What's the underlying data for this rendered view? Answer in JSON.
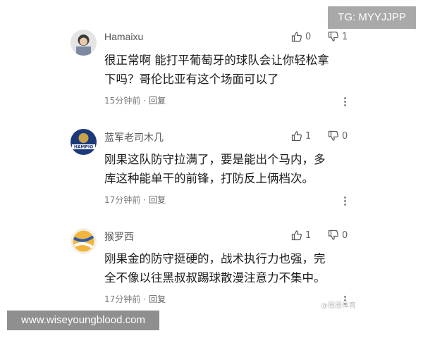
{
  "overlays": {
    "tg_badge": "TG: MYYJJPP",
    "site_watermark": "www.wiseyoungblood.com",
    "source_mark": "@圈圈体育"
  },
  "comments": [
    {
      "username": "Hamaixu",
      "likes": "0",
      "dislikes": "1",
      "line1": "很正常啊 能打平葡萄牙的球队会让你轻松拿",
      "line2": "下吗？哥伦比亚有这个场面可以了",
      "time": "15分钟前",
      "reply": "回复",
      "avatar_color": "#d8d8d8"
    },
    {
      "username": "蓝军老司木几",
      "likes": "1",
      "dislikes": "0",
      "line1": "刚果这队防守拉满了，要是能出个马内，多",
      "line2": "库这种能单干的前锋，打防反上俩档次。",
      "time": "17分钟前",
      "reply": "回复",
      "avatar_color": "#1c3a7a"
    },
    {
      "username": "猴罗西",
      "likes": "1",
      "dislikes": "0",
      "line1": "刚果金的防守挺硬的，战术执行力也强，完",
      "line2": "全不像以往黑叔叔踢球散漫注意力不集中。",
      "time": "17分钟前",
      "reply": "回复",
      "avatar_color": "#f2b640"
    }
  ],
  "separator": "·",
  "icons": {
    "like": "thumbs-up-icon",
    "dislike": "thumbs-down-icon",
    "more": "more-vertical-icon"
  }
}
